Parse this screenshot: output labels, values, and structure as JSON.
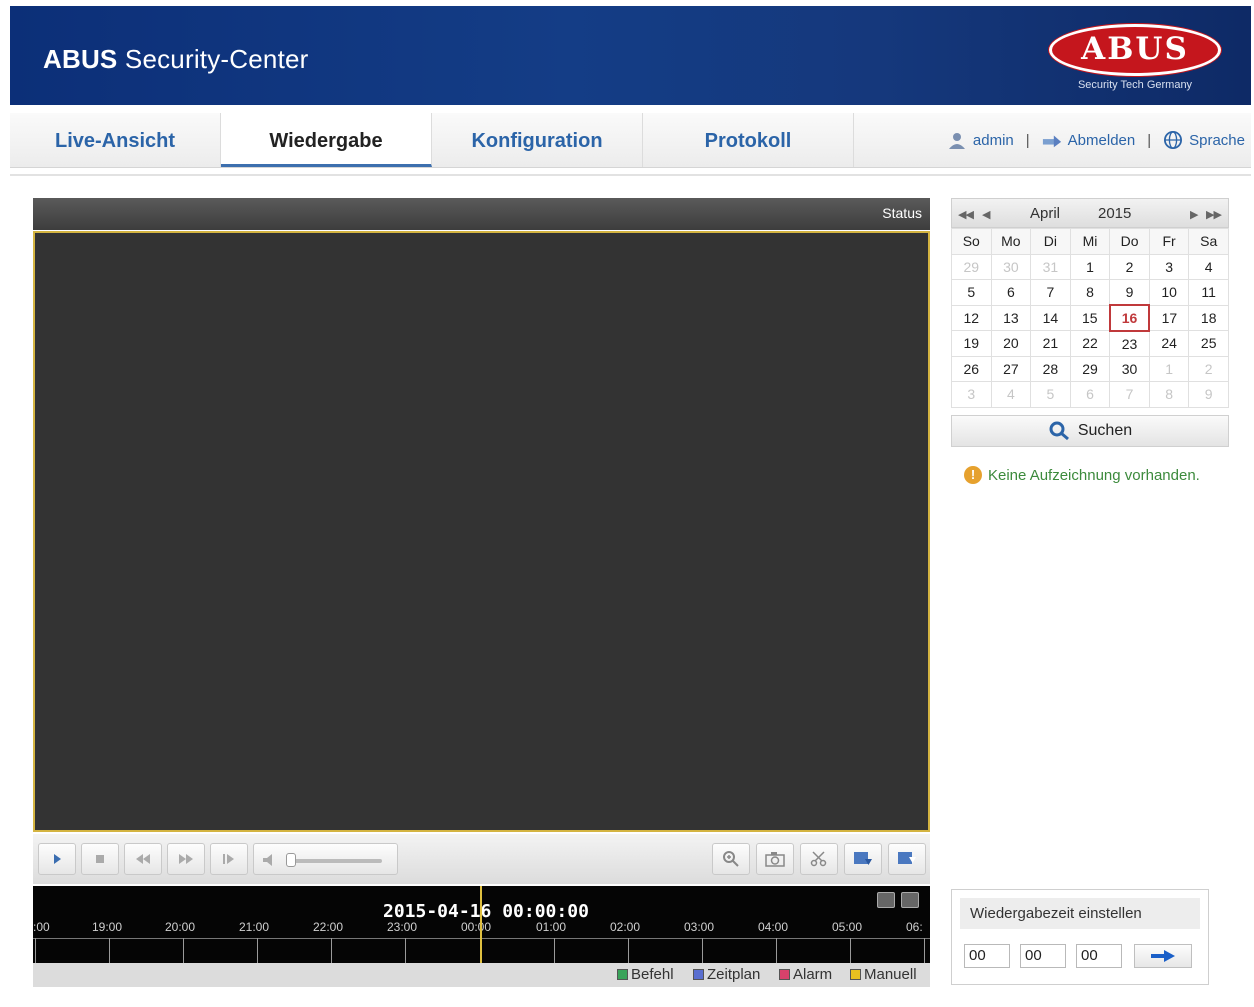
{
  "header": {
    "title_bold": "ABUS",
    "title_rest": " Security-Center",
    "logo_text": "ABUS",
    "logo_sub": "Security Tech Germany"
  },
  "tabs": [
    {
      "label": "Live-Ansicht",
      "active": false
    },
    {
      "label": "Wiedergabe",
      "active": true
    },
    {
      "label": "Konfiguration",
      "active": false
    },
    {
      "label": "Protokoll",
      "active": false
    }
  ],
  "userbar": {
    "user": "admin",
    "sep": "|",
    "logout": "Abmelden",
    "language": "Sprache"
  },
  "video": {
    "status_label": "Status"
  },
  "toolbar": {
    "volume_level": 0.05
  },
  "timeline": {
    "current": "2015-04-16 00:00:00",
    "ticks": [
      ":00",
      "19:00",
      "20:00",
      "21:00",
      "22:00",
      "23:00",
      "00:00",
      "01:00",
      "02:00",
      "03:00",
      "04:00",
      "05:00",
      "06:"
    ],
    "legend": [
      {
        "label": "Befehl",
        "color": "#3aa35a"
      },
      {
        "label": "Zeitplan",
        "color": "#5a6fd0"
      },
      {
        "label": "Alarm",
        "color": "#d8416b"
      },
      {
        "label": "Manuell",
        "color": "#e8c020"
      }
    ]
  },
  "calendar": {
    "month": "April",
    "year": "2015",
    "weekdays": [
      "So",
      "Mo",
      "Di",
      "Mi",
      "Do",
      "Fr",
      "Sa"
    ],
    "weeks": [
      [
        "29",
        "30",
        "31",
        "1",
        "2",
        "3",
        "4"
      ],
      [
        "5",
        "6",
        "7",
        "8",
        "9",
        "10",
        "11"
      ],
      [
        "12",
        "13",
        "14",
        "15",
        "16",
        "17",
        "18"
      ],
      [
        "19",
        "20",
        "21",
        "22",
        "23",
        "24",
        "25"
      ],
      [
        "26",
        "27",
        "28",
        "29",
        "30",
        "1",
        "2"
      ],
      [
        "3",
        "4",
        "5",
        "6",
        "7",
        "8",
        "9"
      ]
    ],
    "today": "16",
    "search_label": "Suchen"
  },
  "notice": "Keine Aufzeichnung vorhanden.",
  "playback_time": {
    "title": "Wiedergabezeit einstellen",
    "hours": "00",
    "minutes": "00",
    "seconds": "00"
  },
  "colors": {
    "header_blue": "#143d86",
    "accent_blue": "#2b64a8",
    "today_red": "#c0393b",
    "cursor_yellow": "#e0c040"
  }
}
